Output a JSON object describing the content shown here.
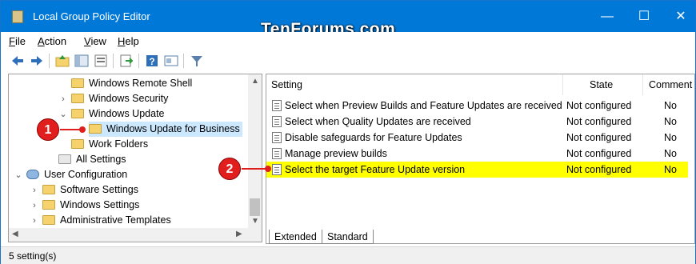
{
  "window": {
    "title": "Local Group Policy Editor",
    "watermark": "TenForums.com",
    "controls": {
      "minimize": "—",
      "maximize": "☐",
      "close": "✕"
    }
  },
  "menu": [
    {
      "label": "File",
      "underline": "F",
      "rest": "ile"
    },
    {
      "label": "Action",
      "underline": "A",
      "rest": "ction"
    },
    {
      "label": "View",
      "underline": "V",
      "rest": "iew"
    },
    {
      "label": "Help",
      "underline": "H",
      "rest": "elp"
    }
  ],
  "toolbar": [
    "back-arrow-icon",
    "forward-arrow-icon",
    "up-folder-icon",
    "show-hide-tree-icon",
    "export-list-icon",
    "help-icon",
    "properties-icon",
    "filter-icon"
  ],
  "tree": [
    {
      "label": "Windows Remote Shell",
      "chevron": "",
      "folder": true
    },
    {
      "label": "Windows Security",
      "chevron": "›",
      "folder": true
    },
    {
      "label": "Windows Update",
      "chevron": "⌄",
      "folder": true
    },
    {
      "label": "Windows Update for Business",
      "chevron": "",
      "folder": true,
      "selected": true
    },
    {
      "label": "Work Folders",
      "chevron": "",
      "folder": true
    },
    {
      "label": "All Settings",
      "chevron": "",
      "folder": false
    },
    {
      "label": "User Configuration",
      "chevron": "⌄",
      "folder": false
    },
    {
      "label": "Software Settings",
      "chevron": "›",
      "folder": true
    },
    {
      "label": "Windows Settings",
      "chevron": "›",
      "folder": true
    },
    {
      "label": "Administrative Templates",
      "chevron": "›",
      "folder": true
    }
  ],
  "columns": {
    "setting": "Setting",
    "state": "State",
    "comment": "Comment"
  },
  "rows": [
    {
      "setting": "Select when Preview Builds and Feature Updates are received",
      "state": "Not configured",
      "comment": "No"
    },
    {
      "setting": "Select when Quality Updates are received",
      "state": "Not configured",
      "comment": "No"
    },
    {
      "setting": "Disable safeguards for Feature Updates",
      "state": "Not configured",
      "comment": "No"
    },
    {
      "setting": "Manage preview builds",
      "state": "Not configured",
      "comment": "No"
    },
    {
      "setting": "Select the target Feature Update version",
      "state": "Not configured",
      "comment": "No",
      "highlighted": true
    }
  ],
  "tabs": [
    "Extended",
    "Standard"
  ],
  "status": "5 setting(s)",
  "callouts": [
    "1",
    "2"
  ],
  "colors": {
    "titlebar": "#0078d7",
    "highlight": "#ffff00",
    "callout": "#e01e1e",
    "selection": "#cce8ff"
  }
}
